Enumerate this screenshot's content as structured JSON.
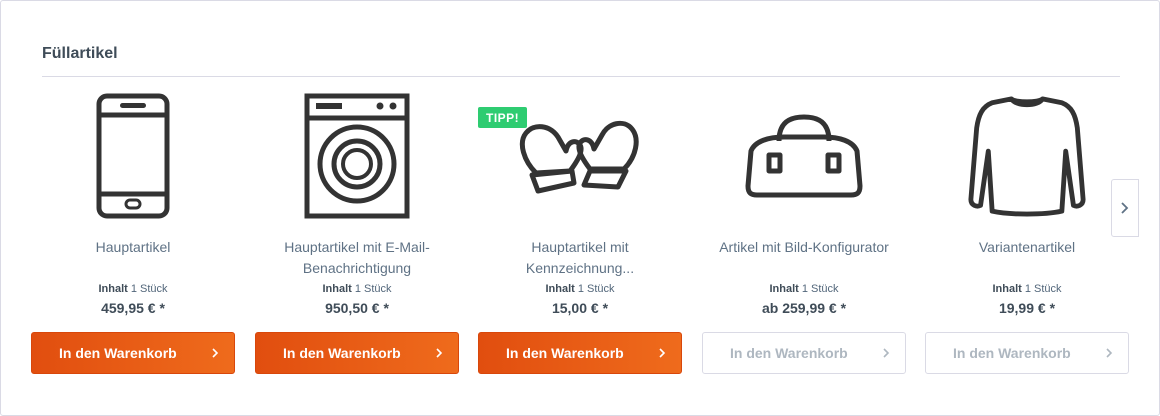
{
  "slider": {
    "title": "Füllartikel",
    "products": [
      {
        "image_icon": "smartphone-icon",
        "name": "Hauptartikel",
        "unit_label": "Inhalt",
        "unit_value": "1 Stück",
        "price": "459,95 € *",
        "button_label": "In den Warenkorb",
        "button_enabled": true
      },
      {
        "image_icon": "washing-machine-icon",
        "name": "Hauptartikel mit E-Mail-Benachrichtigung",
        "unit_label": "Inhalt",
        "unit_value": "1 Stück",
        "price": "950,50 € *",
        "button_label": "In den Warenkorb",
        "button_enabled": true
      },
      {
        "image_icon": "mittens-icon",
        "badge": "TIPP!",
        "name": "Hauptartikel mit Kennzeichnung...",
        "unit_label": "Inhalt",
        "unit_value": "1 Stück",
        "price": "15,00 € *",
        "button_label": "In den Warenkorb",
        "button_enabled": true
      },
      {
        "image_icon": "bag-icon",
        "name": "Artikel mit Bild-Konfigurator",
        "unit_label": "Inhalt",
        "unit_value": "1 Stück",
        "price": "ab 259,99 € *",
        "button_label": "In den Warenkorb",
        "button_enabled": false
      },
      {
        "image_icon": "longsleeve-shirt-icon",
        "name": "Variantenartikel",
        "unit_label": "Inhalt",
        "unit_value": "1 Stück",
        "price": "19,99 € *",
        "button_label": "In den Warenkorb",
        "button_enabled": false
      }
    ],
    "next_icon": "chevron-right-icon"
  },
  "colors": {
    "primary_button": "#e8581a",
    "badge": "#2ecc71",
    "text": "#3f4c58",
    "border": "#dadae5"
  }
}
